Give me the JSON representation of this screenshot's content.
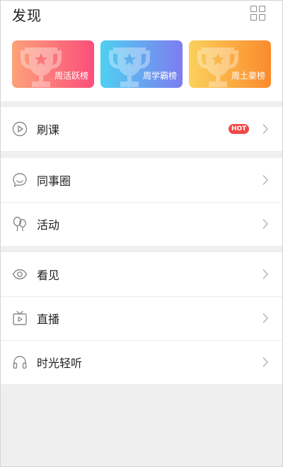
{
  "header": {
    "title": "发现",
    "grid_icon": "grid-icon"
  },
  "rank_cards": [
    {
      "label": "周活跃榜",
      "gradient": [
        "#fca27a",
        "#fb4e7a"
      ]
    },
    {
      "label": "周学霸榜",
      "gradient": [
        "#4fd0f1",
        "#7e7cf0"
      ]
    },
    {
      "label": "周土豪榜",
      "gradient": [
        "#fbd15c",
        "#fb8a2c"
      ]
    }
  ],
  "groups": [
    {
      "items": [
        {
          "label": "刷课",
          "icon": "play-circle-icon",
          "badge": "HOT"
        }
      ]
    },
    {
      "items": [
        {
          "label": "同事圈",
          "icon": "chat-bubble-icon"
        },
        {
          "label": "活动",
          "icon": "balloons-icon"
        }
      ]
    },
    {
      "items": [
        {
          "label": "看见",
          "icon": "eye-icon"
        },
        {
          "label": "直播",
          "icon": "tv-icon"
        },
        {
          "label": "时光轻听",
          "icon": "headphones-icon"
        }
      ]
    }
  ],
  "colors": {
    "badge_red": "#f14848",
    "icon_gray": "#8a8a8a",
    "background": "#efefef"
  }
}
